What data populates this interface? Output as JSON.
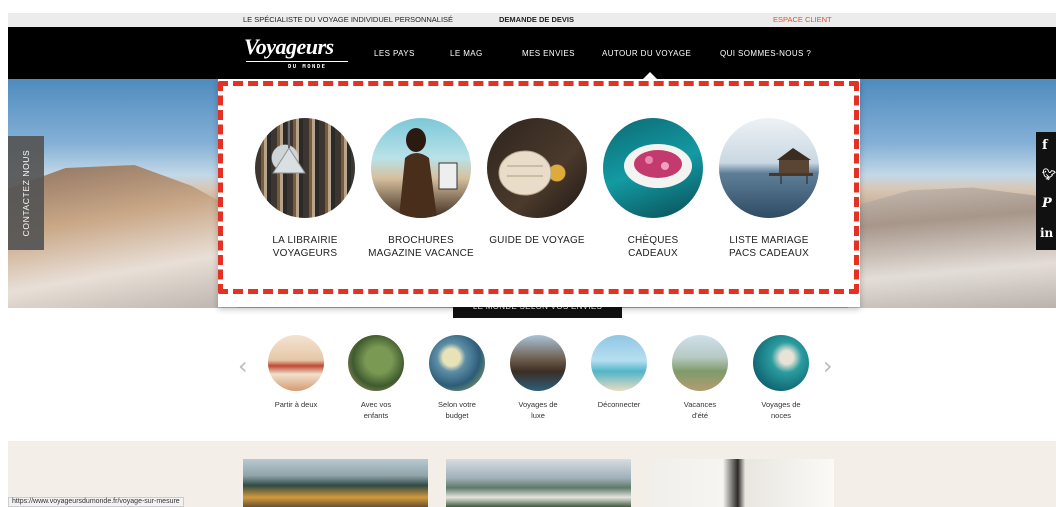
{
  "topbar": {
    "tagline": "LE SPÉCIALISTE DU VOYAGE INDIVIDUEL PERSONNALISÉ",
    "quote": "DEMANDE DE DEVIS",
    "client": "ESPACE CLIENT"
  },
  "logo": {
    "name": "Voyageurs",
    "sub": "DU MONDE"
  },
  "nav": [
    "LES PAYS",
    "LE MAG",
    "MES ENVIES",
    "AUTOUR DU VOYAGE",
    "QUI SOMMES-NOUS ?"
  ],
  "contact_tab": "CONTACTEZ NOUS",
  "social": [
    "f",
    "t",
    "P",
    "in"
  ],
  "dropdown": [
    {
      "line1": "LA LIBRAIRIE",
      "line2": "VOYAGEURS"
    },
    {
      "line1": "BROCHURES",
      "line2": "MAGAZINE VACANCE"
    },
    {
      "line1": "GUIDE DE VOYAGE",
      "line2": ""
    },
    {
      "line1": "CHÈQUES",
      "line2": "CADEAUX"
    },
    {
      "line1": "LISTE MARIAGE",
      "line2": "PACS CADEAUX"
    }
  ],
  "envies_button": "LE MONDE SELON VOS ENVIES",
  "carousel": [
    {
      "l1": "Partir à deux",
      "l2": ""
    },
    {
      "l1": "Avec vos",
      "l2": "enfants"
    },
    {
      "l1": "Selon votre",
      "l2": "budget"
    },
    {
      "l1": "Voyages de",
      "l2": "luxe"
    },
    {
      "l1": "Déconnecter",
      "l2": ""
    },
    {
      "l1": "Vacances",
      "l2": "d'été"
    },
    {
      "l1": "Voyages de",
      "l2": "noces"
    }
  ],
  "status_url": "https://www.voyageursdumonde.fr/voyage-sur-mesure",
  "colors": {
    "accent": "#e53124",
    "client": "#e0522e",
    "nav_bg": "#000000"
  }
}
